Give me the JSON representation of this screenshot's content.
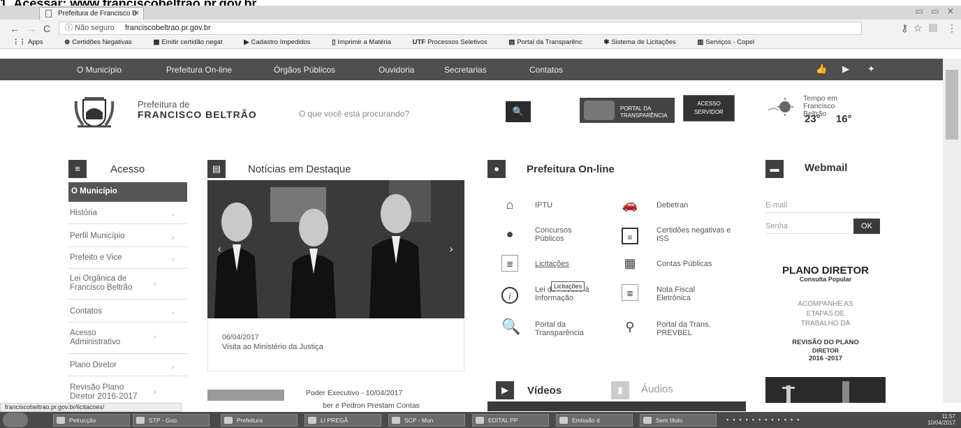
{
  "instruction": {
    "prefix": "1. Acessar:",
    "url": "www.franciscobeltrao.pr.gov.br"
  },
  "browser": {
    "tab_title": "Prefeitura de Francisco B",
    "tab_close": "×",
    "window_controls": "▭ ▭ ✕",
    "address_security": "ⓘ Não seguro",
    "address_url": "franciscobeltrao.pr.gov.br",
    "bookmarks": [
      "Apps",
      "Certidões Negativas",
      "Emitir certidão negat",
      "Cadastro Impedidos",
      "Imprimir a Matéria",
      "Processos Seletivos",
      "Portal da Transparênc",
      "Sistema de Licitações",
      "Serviços - Copel"
    ],
    "status_url": "franciscobeltrao.pr.gov.br/licitacoes/"
  },
  "menu": [
    "O Município",
    "Prefeitura On-line",
    "Órgãos Públicos",
    "Ouvidoria",
    "Secretarias",
    "Contatos"
  ],
  "header": {
    "pref_line1": "Prefeitura de",
    "pref_line2": "FRANCISCO BELTRÃO",
    "search_placeholder": "O que você está procurando?",
    "portal_label": "PORTAL DA TRANSPARÊNCIA",
    "acesso_label": "ACESSO SERVIDOR",
    "weather_label": "Tempo em Francisco Beltrão",
    "temp_max": "23°",
    "temp_min": "16°"
  },
  "acesso": {
    "title": "Acesso",
    "active": "O Município",
    "items": [
      "História",
      "Perfil Município",
      "Prefeito e Vice",
      "Lei Orgânica de Francisco Beltrão",
      "Contatos",
      "Acesso Administrativo",
      "Plano Diretor",
      "Revisão Plano Diretor 2016-2017"
    ]
  },
  "news": {
    "title": "Notícias em Destaque",
    "date": "06/04/2017",
    "headline": "Visita ao Ministério da Justiça",
    "item2": "Poder Executivo - 10/04/2017",
    "item2_sub": "ber e Pedron Prestam Contas"
  },
  "online": {
    "title": "Prefeitura On-line",
    "items": [
      {
        "label": "IPTU",
        "icon": "home-icon"
      },
      {
        "label": "Debetran",
        "icon": "car-icon"
      },
      {
        "label": "Concursos Públicos",
        "icon": "user-icon"
      },
      {
        "label": "Certidões negativas e ISS",
        "icon": "document-icon"
      },
      {
        "label": "Licitações",
        "icon": "list-icon"
      },
      {
        "label": "Contas Públicas",
        "icon": "calculator-icon"
      },
      {
        "label": "Lei de Acesso à Informação",
        "icon": "info-icon"
      },
      {
        "label": "Nota Fiscal Eletrônica",
        "icon": "invoice-icon"
      },
      {
        "label": "Portal da Transparência",
        "icon": "magnifier-icon"
      },
      {
        "label": "Portal da Trans. PREVBEL",
        "icon": "pin-icon"
      }
    ],
    "tooltip": "Licitações",
    "videos": "Vídeos",
    "audios": "Áudios"
  },
  "webmail": {
    "title": "Webmail",
    "email_placeholder": "E-mail",
    "password_placeholder": "Senha",
    "ok": "OK"
  },
  "plano": {
    "title": "PLANO DIRETOR",
    "subtitle": "Consulta Popular",
    "line1": "ACOMPANHE AS",
    "line2": "ETAPAS DE",
    "line3": "TRABALHO DA",
    "revisao": "REVISÃO DO PLANO",
    "diretor": "DIRETOR",
    "years": "2016 -2017"
  },
  "taskbar": [
    "Petrucção",
    "STP - Goo",
    "Prefeitura",
    "LI PREGÃ",
    "SCP - Mun",
    "EDITAL PP",
    "Emissão d",
    "Sem título"
  ],
  "clock": {
    "time": "11:57",
    "date": "10/04/2017"
  }
}
